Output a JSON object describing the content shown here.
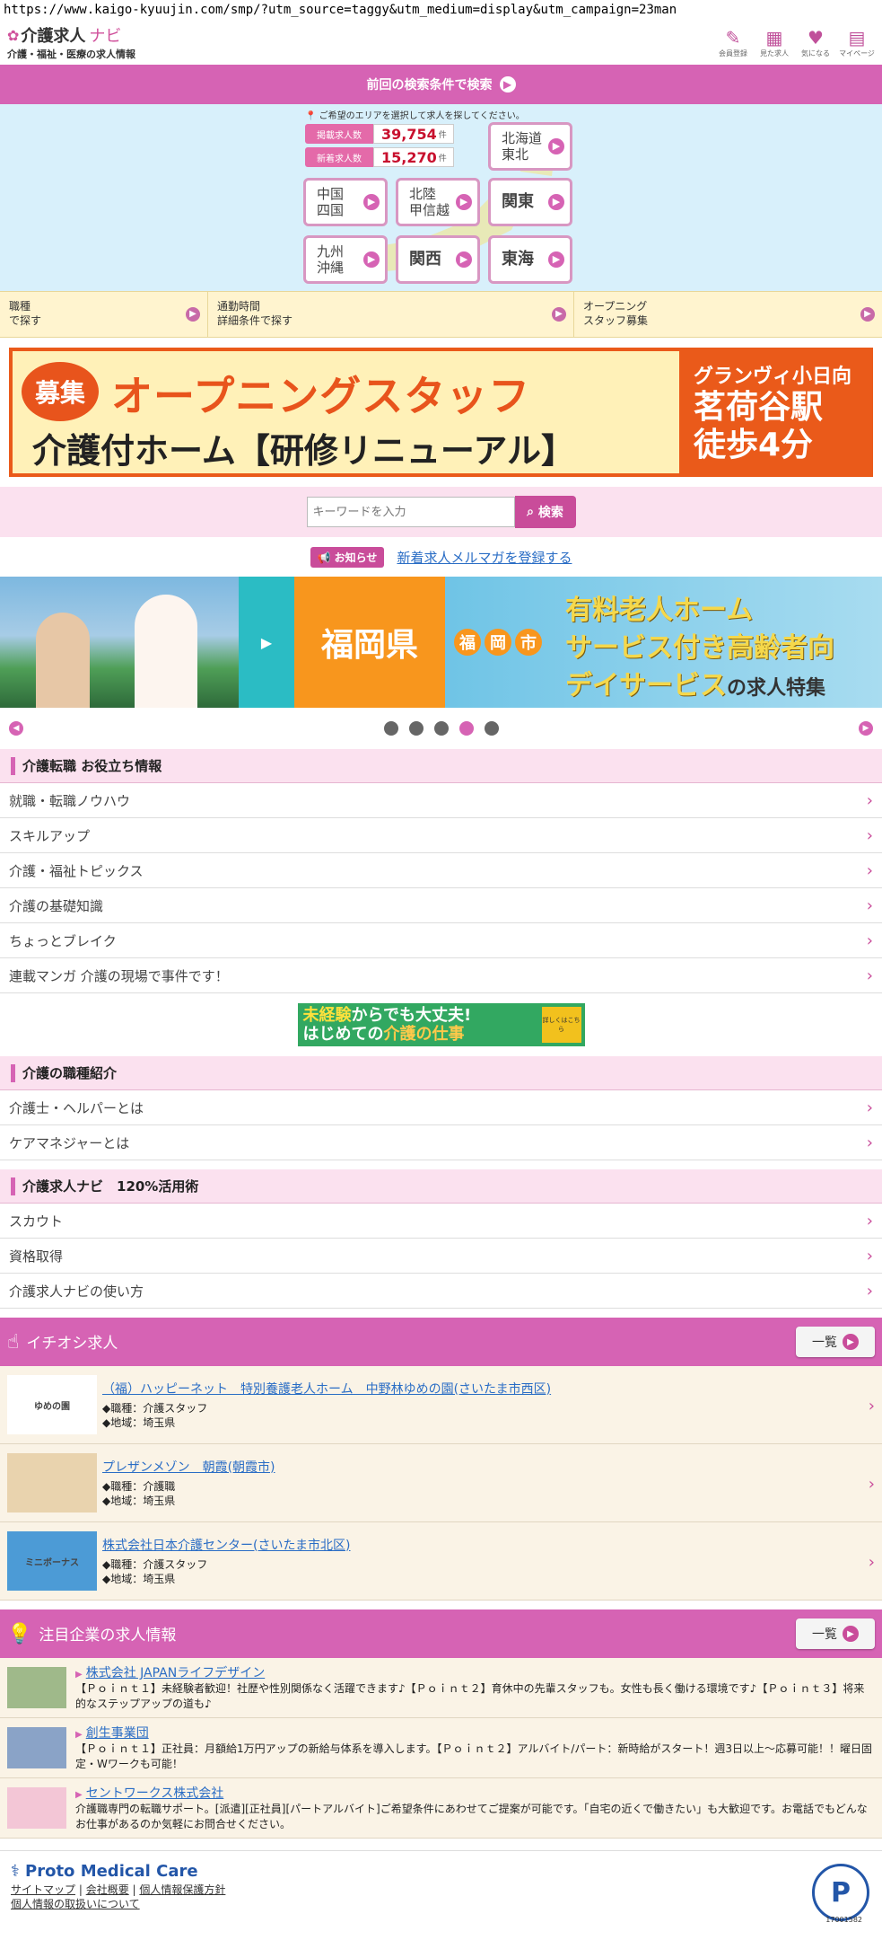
{
  "browser": {
    "url": "https://www.kaigo-kyuujin.com/smp/?utm_source=taggy&utm_medium=display&utm_campaign=23man"
  },
  "header": {
    "logo_title": "介護求人",
    "logo_navi": "ナビ",
    "logo_sub": "介護・福祉・医療の求人情報",
    "icons": [
      {
        "name": "pen-icon",
        "glyph": "✎",
        "label": "会員登録"
      },
      {
        "name": "calendar-icon",
        "glyph": "▦",
        "label": "見た求人"
      },
      {
        "name": "heart-icon",
        "glyph": "♥",
        "label": "気になる"
      },
      {
        "name": "id-card-icon",
        "glyph": "▤",
        "label": "マイページ"
      }
    ]
  },
  "prev_search": {
    "label": "前回の検索条件で検索"
  },
  "area": {
    "note": "ご希望のエリアを選択して求人を探してください。",
    "stats": [
      {
        "label": "掲載求人数",
        "value": "39,754",
        "unit": "件"
      },
      {
        "label": "新着求人数",
        "value": "15,270",
        "unit": "件"
      }
    ],
    "regions": {
      "hokkaido": "北海道\n東北",
      "chugoku": "中国\n四国",
      "hokuriku": "北陸\n甲信越",
      "kanto": "関東",
      "kyushu": "九州\n沖縄",
      "kansai": "関西",
      "tokai": "東海"
    }
  },
  "search_tabs": [
    "職種\nで探す",
    "通勤時間\n詳細条件で探す",
    "オープニング\nスタッフ募集"
  ],
  "banner1": {
    "badge": "募集",
    "title": "オープニングスタッフ",
    "subtitle": "介護付ホーム【研修リニューアル】",
    "facility": "グランヴィ小日向",
    "access": "茗荷谷駅\n徒歩4分"
  },
  "keyword": {
    "placeholder": "キーワードを入力",
    "button": "検索"
  },
  "magazine": {
    "badge": "お知らせ",
    "link": "新着求人メルマガを登録する"
  },
  "banner2": {
    "pref": "福岡県",
    "city": [
      "福",
      "岡",
      "市"
    ],
    "line1": "有料老人ホーム",
    "line2": "サービス付き高齢者向",
    "line3": "デイサービス",
    "line3_suffix": "の求人特集"
  },
  "pager": {
    "total": 5,
    "active_index": 3
  },
  "tips": {
    "heading": "介護転職 お役立ち情報",
    "items": [
      "就職・転職ノウハウ",
      "スキルアップ",
      "介護・福祉トピックス",
      "介護の基礎知識",
      "ちょっとブレイク",
      "連載マンガ 介護の現場で事件です！"
    ]
  },
  "mini_banner": {
    "part1": "未経験",
    "part2": "からでも大丈夫!",
    "part3": "はじめての",
    "part4": "介護の仕事",
    "side": "詳しくはこちら"
  },
  "jobtypes": {
    "heading": "介護の職種紹介",
    "items": [
      "介護士・ヘルパーとは",
      "ケアマネジャーとは"
    ]
  },
  "usage": {
    "heading": "介護求人ナビ　120%活用術",
    "items": [
      "スカウト",
      "資格取得",
      "介護求人ナビの使い方"
    ]
  },
  "pickup": {
    "heading": "イチオシ求人",
    "list_button": "一覧",
    "jobs": [
      {
        "title": "（福）ハッピーネット　特別養護老人ホーム　中野林ゆめの園(さいたま市西区)",
        "job": "◆職種：介護スタッフ",
        "area": "◆地域：埼玉県",
        "thumb_text": "ゆめの園",
        "thumb_color": "#ffffff"
      },
      {
        "title": "プレザンメゾン　朝霞(朝霞市)",
        "job": "◆職種：介護職",
        "area": "◆地域：埼玉県",
        "thumb_text": "",
        "thumb_color": "#e9d3ae"
      },
      {
        "title": "株式会社日本介護センター(さいたま市北区)",
        "job": "◆職種：介護スタッフ",
        "area": "◆地域：埼玉県",
        "thumb_text": "ミニボーナス",
        "thumb_color": "#4c9bd6"
      }
    ]
  },
  "companies": {
    "heading": "注目企業の求人情報",
    "list_button": "一覧",
    "items": [
      {
        "name": "株式会社 JAPANライフデザイン",
        "desc": "【Ｐｏｉｎｔ１】未経験者歓迎！社歴や性別関係なく活躍できます♪【Ｐｏｉｎｔ２】育休中の先輩スタッフも。女性も長く働ける環境です♪【Ｐｏｉｎｔ３】将来的なステップアップの道も♪",
        "thumb_color": "#9fb98a"
      },
      {
        "name": "創生事業団",
        "desc": "【Ｐｏｉｎｔ１】正社員：月額給1万円アップの新給与体系を導入します。【Ｐｏｉｎｔ２】アルバイト/パート：新時給がスタート！週3日以上〜応募可能！！曜日固定・Wワークも可能！",
        "thumb_color": "#8aa3c7"
      },
      {
        "name": "セントワークス株式会社",
        "desc": "介護職専門の転職サポート。[派遣][正社員][パートアルバイト]ご希望条件にあわせてご提案が可能です。「自宅の近くで働きたい」も大歓迎です。お電話でもどんなお仕事があるのか気軽にお問合せください。",
        "thumb_color": "#f3c6d6"
      }
    ]
  },
  "footer": {
    "logo": "Proto Medical Care",
    "links": [
      "サイトマップ",
      "会社概要",
      "個人情報保護方針",
      "個人情報の取扱いについて"
    ],
    "pmark_number": "17001582"
  }
}
